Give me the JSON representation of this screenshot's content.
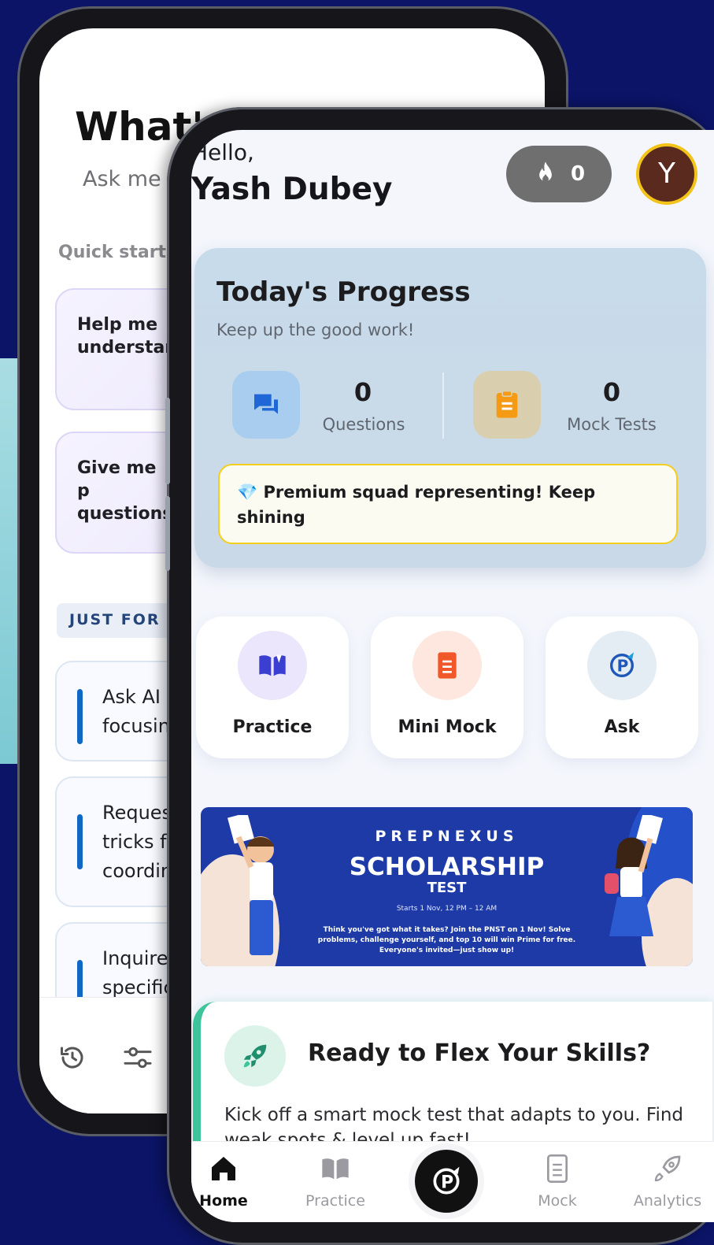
{
  "back_phone": {
    "title": "What's",
    "subtitle": "Ask me d",
    "quick_start_label": "Quick starte",
    "quick_cards": [
      {
        "text": "Help me\nunderstan"
      },
      {
        "text": "Give me p\nquestions"
      }
    ],
    "just_for_you_label": "JUST FOR YO",
    "suggestions": [
      {
        "text": "Ask AI f\nfocusin"
      },
      {
        "text": "Reques\ntricks fo\ncoordin"
      },
      {
        "text": "Inquire\nspecific"
      }
    ],
    "bottom_icons": [
      "history-icon",
      "sliders-icon"
    ]
  },
  "front_phone": {
    "greeting": "Hello,",
    "user_name": "Yash Dubey",
    "streak_count": "0",
    "avatar_letter": "Y",
    "progress": {
      "title": "Today's Progress",
      "subtitle": "Keep up the good work!",
      "questions_count": "0",
      "questions_label": "Questions",
      "mock_tests_count": "0",
      "mock_tests_label": "Mock Tests",
      "premium_message": "💎 Premium squad representing! Keep shining"
    },
    "actions": [
      {
        "label": "Practice",
        "icon": "book-icon"
      },
      {
        "label": "Mini Mock",
        "icon": "document-icon"
      },
      {
        "label": "Ask",
        "icon": "prepnexus-logo-icon"
      }
    ],
    "banner": {
      "brand": "PREPNEXUS",
      "title": "SCHOLARSHIP",
      "subtitle": "TEST",
      "date": "Starts 1 Nov, 12 PM – 12 AM",
      "description": "Think you've got what it takes? Join the PNST on 1 Nov! Solve problems, challenge yourself, and top 10 will win Prime for free. Everyone's invited—just show up!"
    },
    "flex_card": {
      "title": "Ready to Flex Your Skills?",
      "description": "Kick off a smart mock test that adapts to you. Find weak spots & level up fast!"
    },
    "tabs": [
      {
        "label": "Home",
        "active": true
      },
      {
        "label": "Practice",
        "active": false
      },
      {
        "label": "Mock",
        "active": false
      },
      {
        "label": "Analytics",
        "active": false
      }
    ]
  },
  "colors": {
    "background": "#0b1466",
    "accent_yellow": "#f3cf1c",
    "accent_green": "#3ec49a",
    "banner_blue": "#1d3aa6"
  }
}
